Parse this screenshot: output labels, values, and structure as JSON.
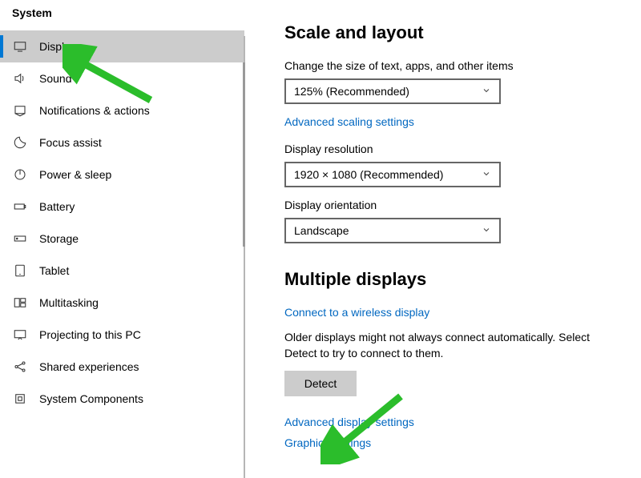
{
  "sidebar": {
    "title": "System",
    "items": [
      {
        "icon": "display-icon",
        "label": "Display",
        "active": true
      },
      {
        "icon": "sound-icon",
        "label": "Sound"
      },
      {
        "icon": "notifications-icon",
        "label": "Notifications & actions"
      },
      {
        "icon": "focus-assist-icon",
        "label": "Focus assist"
      },
      {
        "icon": "power-sleep-icon",
        "label": "Power & sleep"
      },
      {
        "icon": "battery-icon",
        "label": "Battery"
      },
      {
        "icon": "storage-icon",
        "label": "Storage"
      },
      {
        "icon": "tablet-icon",
        "label": "Tablet"
      },
      {
        "icon": "multitasking-icon",
        "label": "Multitasking"
      },
      {
        "icon": "projecting-icon",
        "label": "Projecting to this PC"
      },
      {
        "icon": "shared-exp-icon",
        "label": "Shared experiences"
      },
      {
        "icon": "system-comp-icon",
        "label": "System Components"
      }
    ]
  },
  "main": {
    "scale_section_title": "Scale and layout",
    "scale_label": "Change the size of text, apps, and other items",
    "scale_value": "125% (Recommended)",
    "advanced_scaling_link": "Advanced scaling settings",
    "resolution_label": "Display resolution",
    "resolution_value": "1920 × 1080 (Recommended)",
    "orientation_label": "Display orientation",
    "orientation_value": "Landscape",
    "multiple_section_title": "Multiple displays",
    "connect_wireless_link": "Connect to a wireless display",
    "older_displays_text": "Older displays might not always connect automatically. Select Detect to try to connect to them.",
    "detect_button": "Detect",
    "advanced_display_link": "Advanced display settings",
    "graphics_settings_link": "Graphics settings"
  }
}
